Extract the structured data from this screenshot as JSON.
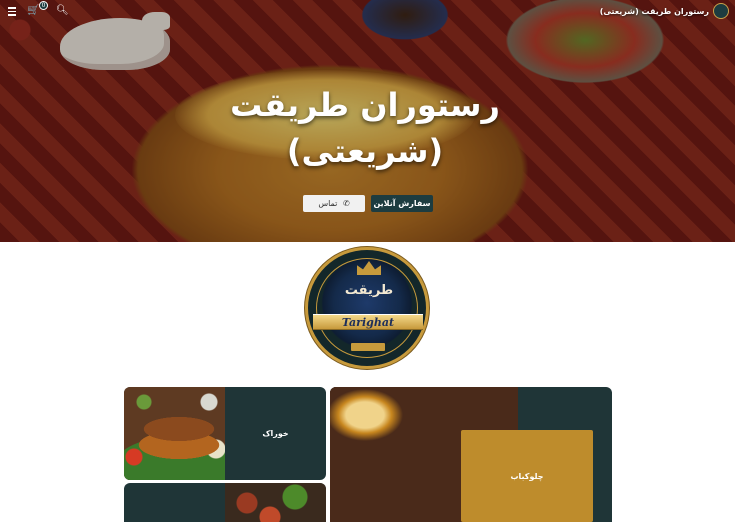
{
  "site": {
    "brand_name": "رستوران طریقت (شریعتی)",
    "cart_count": "0"
  },
  "hero": {
    "title": "رستوران طریقت (شریعتی)",
    "order_button": "سفارش آنلاین",
    "call_button": "تماس"
  },
  "logo": {
    "script_text": "طریقت",
    "ribbon_text": "Tarighat"
  },
  "categories": [
    {
      "label": "خوراک"
    },
    {
      "label": "چلوکباب"
    }
  ],
  "colors": {
    "accent_dark": "#1d3c40",
    "accent_gold": "#be8c2c",
    "tile_dark": "#1f3537"
  },
  "icons": {
    "menu": "menu-icon",
    "cart": "cart-icon",
    "search": "search-icon",
    "phone": "phone-icon"
  }
}
